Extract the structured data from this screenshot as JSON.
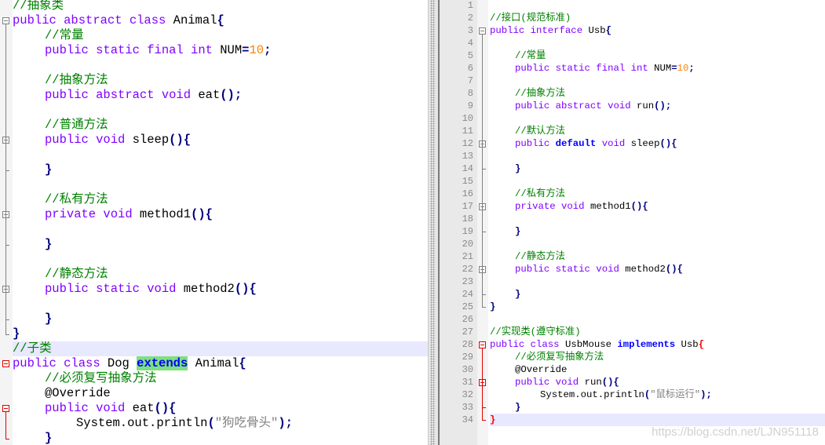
{
  "left_editor": {
    "current_line": 24,
    "lines": [
      {
        "i": 0,
        "t": [
          [
            "c",
            "//抽象类"
          ]
        ]
      },
      {
        "i": 0,
        "f": "box",
        "t": [
          [
            "k",
            "public abstract class "
          ],
          [
            "t",
            "Animal"
          ],
          [
            "o",
            "{"
          ]
        ]
      },
      {
        "i": 1,
        "t": [
          [
            "c",
            "//常量"
          ]
        ]
      },
      {
        "i": 1,
        "t": [
          [
            "k",
            "public static final int "
          ],
          [
            "t",
            "NUM"
          ],
          [
            "o",
            "="
          ],
          [
            "n",
            "10"
          ],
          [
            "o",
            ";"
          ]
        ]
      },
      {
        "i": 1,
        "t": []
      },
      {
        "i": 1,
        "t": [
          [
            "c",
            "//抽象方法"
          ]
        ]
      },
      {
        "i": 1,
        "t": [
          [
            "k",
            "public abstract void "
          ],
          [
            "t",
            "eat"
          ],
          [
            "o",
            "();"
          ]
        ]
      },
      {
        "i": 1,
        "t": []
      },
      {
        "i": 1,
        "t": [
          [
            "c",
            "//普通方法"
          ]
        ]
      },
      {
        "i": 1,
        "f": "box",
        "t": [
          [
            "k",
            "public void "
          ],
          [
            "t",
            "sleep"
          ],
          [
            "o",
            "(){"
          ]
        ]
      },
      {
        "i": 1,
        "t": []
      },
      {
        "i": 1,
        "f": "end",
        "t": [
          [
            "o",
            "}"
          ]
        ]
      },
      {
        "i": 1,
        "t": []
      },
      {
        "i": 1,
        "t": [
          [
            "c",
            "//私有方法"
          ]
        ]
      },
      {
        "i": 1,
        "f": "box",
        "t": [
          [
            "k",
            "private void "
          ],
          [
            "t",
            "method1"
          ],
          [
            "o",
            "(){"
          ]
        ]
      },
      {
        "i": 1,
        "t": []
      },
      {
        "i": 1,
        "f": "end",
        "t": [
          [
            "o",
            "}"
          ]
        ]
      },
      {
        "i": 1,
        "t": []
      },
      {
        "i": 1,
        "t": [
          [
            "c",
            "//静态方法"
          ]
        ]
      },
      {
        "i": 1,
        "f": "box",
        "t": [
          [
            "k",
            "public static void "
          ],
          [
            "t",
            "method2"
          ],
          [
            "o",
            "(){"
          ]
        ]
      },
      {
        "i": 1,
        "t": []
      },
      {
        "i": 1,
        "f": "end",
        "t": [
          [
            "o",
            "}"
          ]
        ]
      },
      {
        "i": 0,
        "f": "end",
        "t": [
          [
            "o",
            "}"
          ]
        ]
      },
      {
        "i": 0,
        "t": [
          [
            "c",
            "//子类"
          ]
        ]
      },
      {
        "i": 0,
        "f": "boxred",
        "t": [
          [
            "k",
            "public class "
          ],
          [
            "t",
            "Dog "
          ],
          [
            "e",
            "extends"
          ],
          [
            "t",
            " Animal"
          ],
          [
            "o",
            "{"
          ]
        ]
      },
      {
        "i": 1,
        "t": [
          [
            "c",
            "//必须复写抽象方法"
          ]
        ]
      },
      {
        "i": 1,
        "t": [
          [
            "t",
            "@Override"
          ]
        ]
      },
      {
        "i": 1,
        "f": "box",
        "t": [
          [
            "k",
            "public void "
          ],
          [
            "t",
            "eat"
          ],
          [
            "o",
            "(){"
          ]
        ]
      },
      {
        "i": 2,
        "t": [
          [
            "t",
            "System.out.println"
          ],
          [
            "o",
            "("
          ],
          [
            "s",
            "\"狗吃骨头\""
          ],
          [
            "o",
            ");"
          ]
        ]
      },
      {
        "i": 1,
        "f": "end",
        "t": [
          [
            "o",
            "}"
          ]
        ]
      }
    ]
  },
  "right_editor": {
    "current_line": 34,
    "lines": [
      {
        "i": 0,
        "t": []
      },
      {
        "i": 0,
        "t": [
          [
            "c",
            "//接口(规范标准)"
          ]
        ]
      },
      {
        "i": 0,
        "f": "box",
        "t": [
          [
            "k",
            "public interface "
          ],
          [
            "t",
            "Usb"
          ],
          [
            "o",
            "{"
          ]
        ]
      },
      {
        "i": 0,
        "t": []
      },
      {
        "i": 1,
        "t": [
          [
            "c",
            "//常量"
          ]
        ]
      },
      {
        "i": 1,
        "t": [
          [
            "k",
            "public static final int "
          ],
          [
            "t",
            "NUM"
          ],
          [
            "o",
            "="
          ],
          [
            "n",
            "10"
          ],
          [
            "o",
            ";"
          ]
        ]
      },
      {
        "i": 1,
        "t": []
      },
      {
        "i": 1,
        "t": [
          [
            "c",
            "//抽象方法"
          ]
        ]
      },
      {
        "i": 1,
        "t": [
          [
            "k",
            "public abstract void "
          ],
          [
            "t",
            "run"
          ],
          [
            "o",
            "();"
          ]
        ]
      },
      {
        "i": 1,
        "t": []
      },
      {
        "i": 1,
        "t": [
          [
            "c",
            "//默认方法"
          ]
        ]
      },
      {
        "i": 1,
        "f": "box",
        "t": [
          [
            "k",
            "public "
          ],
          [
            "b",
            "default"
          ],
          [
            "k",
            " void "
          ],
          [
            "t",
            "sleep"
          ],
          [
            "o",
            "(){"
          ]
        ]
      },
      {
        "i": 1,
        "t": []
      },
      {
        "i": 1,
        "f": "end",
        "t": [
          [
            "o",
            "}"
          ]
        ]
      },
      {
        "i": 1,
        "t": []
      },
      {
        "i": 1,
        "t": [
          [
            "c",
            "//私有方法"
          ]
        ]
      },
      {
        "i": 1,
        "f": "box",
        "t": [
          [
            "k",
            "private void "
          ],
          [
            "t",
            "method1"
          ],
          [
            "o",
            "(){"
          ]
        ]
      },
      {
        "i": 1,
        "t": []
      },
      {
        "i": 1,
        "f": "end",
        "t": [
          [
            "o",
            "}"
          ]
        ]
      },
      {
        "i": 1,
        "t": []
      },
      {
        "i": 1,
        "t": [
          [
            "c",
            "//静态方法"
          ]
        ]
      },
      {
        "i": 1,
        "f": "box",
        "t": [
          [
            "k",
            "public static void "
          ],
          [
            "t",
            "method2"
          ],
          [
            "o",
            "(){"
          ]
        ]
      },
      {
        "i": 1,
        "t": []
      },
      {
        "i": 1,
        "f": "end",
        "t": [
          [
            "o",
            "}"
          ]
        ]
      },
      {
        "i": 0,
        "f": "end",
        "t": [
          [
            "o",
            "}"
          ]
        ]
      },
      {
        "i": 0,
        "t": []
      },
      {
        "i": 0,
        "t": [
          [
            "c",
            "//实现类(遵守标准)"
          ]
        ]
      },
      {
        "i": 0,
        "f": "boxred",
        "t": [
          [
            "k",
            "public class "
          ],
          [
            "t",
            "UsbMouse "
          ],
          [
            "b",
            "implements"
          ],
          [
            "t",
            " Usb"
          ],
          [
            "r",
            "{"
          ]
        ]
      },
      {
        "i": 1,
        "t": [
          [
            "c",
            "//必须复写抽象方法"
          ]
        ]
      },
      {
        "i": 1,
        "t": [
          [
            "t",
            "@Override"
          ]
        ]
      },
      {
        "i": 1,
        "f": "box",
        "t": [
          [
            "k",
            "public void "
          ],
          [
            "t",
            "run"
          ],
          [
            "o",
            "(){"
          ]
        ]
      },
      {
        "i": 2,
        "t": [
          [
            "t",
            "System.out.println"
          ],
          [
            "o",
            "("
          ],
          [
            "s",
            "\"鼠标运行\""
          ],
          [
            "o",
            ");"
          ]
        ]
      },
      {
        "i": 1,
        "f": "end",
        "t": [
          [
            "o",
            "}"
          ]
        ]
      },
      {
        "i": 0,
        "f": "endred",
        "t": [
          [
            "r",
            "}"
          ]
        ]
      }
    ]
  },
  "watermark": "https://blog.csdn.net/LJN951118",
  "colors": {
    "keyword": "#8000ff",
    "comment": "#008000",
    "number": "#ff8000",
    "operator": "#000080",
    "string": "#808080",
    "type_keyword": "#0000ff",
    "current_line": "#e8e8ff"
  }
}
